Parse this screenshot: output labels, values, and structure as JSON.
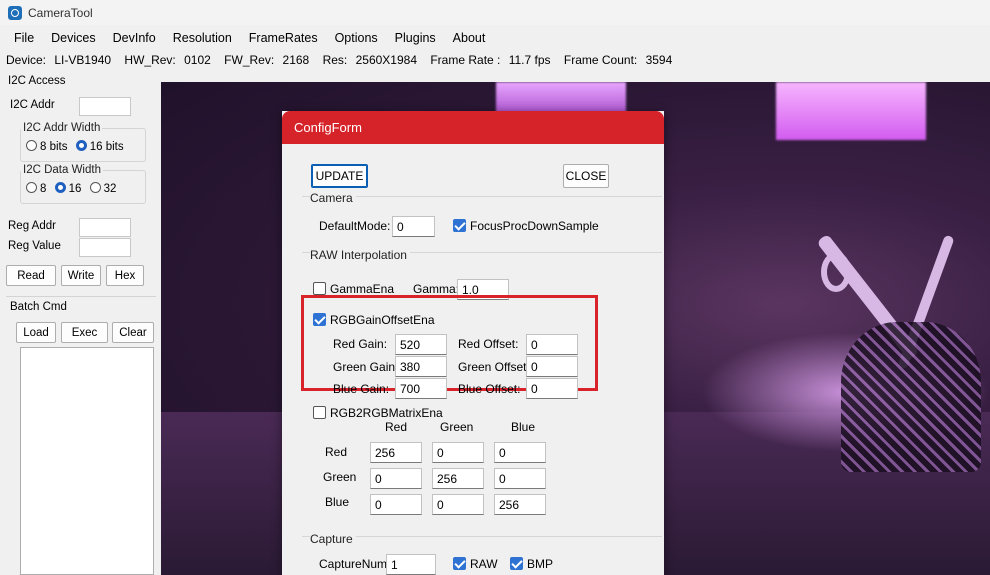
{
  "window": {
    "title": "CameraTool"
  },
  "menu": [
    "File",
    "Devices",
    "DevInfo",
    "Resolution",
    "FrameRates",
    "Options",
    "Plugins",
    "About"
  ],
  "status": {
    "device_label": "Device:",
    "device": "LI-VB1940",
    "hw_label": "HW_Rev:",
    "hw": "0102",
    "fw_label": "FW_Rev:",
    "fw": "2168",
    "res_label": "Res:",
    "res": "2560X1984",
    "fps_label": "Frame Rate :",
    "fps": "11.7 fps",
    "count_label": "Frame Count:",
    "count": "3594"
  },
  "i2c": {
    "group_title": "I2C Access",
    "addr_label": "I2C Addr",
    "addr_value": "",
    "addr_width_title": "I2C Addr Width",
    "addr_width_options": [
      "8 bits",
      "16 bits"
    ],
    "addr_width_selected": "16 bits",
    "data_width_title": "I2C Data Width",
    "data_width_options": [
      "8",
      "16",
      "32"
    ],
    "data_width_selected": "16",
    "reg_addr_label": "Reg Addr",
    "reg_addr_value": "",
    "reg_value_label": "Reg Value",
    "reg_value_value": "",
    "read_label": "Read",
    "write_label": "Write",
    "hex_label": "Hex"
  },
  "batch": {
    "group_title": "Batch Cmd",
    "load_label": "Load",
    "exec_label": "Exec",
    "clear_label": "Clear"
  },
  "config": {
    "title": "ConfigForm",
    "update_label": "UPDATE",
    "close_label": "CLOSE",
    "camera": {
      "section_title": "Camera",
      "default_mode_label": "DefaultMode:",
      "default_mode_value": "0",
      "focus_label": "FocusProcDownSample",
      "focus_checked": true
    },
    "raw": {
      "section_title": "RAW Interpolation",
      "gamma_ena_label": "GammaEna",
      "gamma_ena_checked": false,
      "gamma_label": "Gamma:",
      "gamma_value": "1.0"
    },
    "rgb_gain": {
      "ena_label": "RGBGainOffsetEna",
      "ena_checked": true,
      "red_gain_label": "Red Gain:",
      "red_gain": "520",
      "green_gain_label": "Green Gain:",
      "green_gain": "380",
      "blue_gain_label": "Blue Gain:",
      "blue_gain": "700",
      "red_offset_label": "Red Offset:",
      "red_offset": "0",
      "green_offset_label": "Green Offset:",
      "green_offset": "0",
      "blue_offset_label": "Blue Offset:",
      "blue_offset": "0",
      "highlight_color": "#d8232a"
    },
    "matrix": {
      "ena_label": "RGB2RGBMatrixEna",
      "ena_checked": false,
      "col_headers": [
        "Red",
        "Green",
        "Blue"
      ],
      "row_headers": [
        "Red",
        "Green",
        "Blue"
      ],
      "values": [
        [
          "256",
          "0",
          "0"
        ],
        [
          "0",
          "256",
          "0"
        ],
        [
          "0",
          "0",
          "256"
        ]
      ]
    },
    "capture": {
      "section_title": "Capture",
      "num_label": "CaptureNum:",
      "num_value": "1",
      "raw_label": "RAW",
      "raw_checked": true,
      "bmp_label": "BMP",
      "bmp_checked": true
    },
    "title_color": "#d6232a"
  }
}
